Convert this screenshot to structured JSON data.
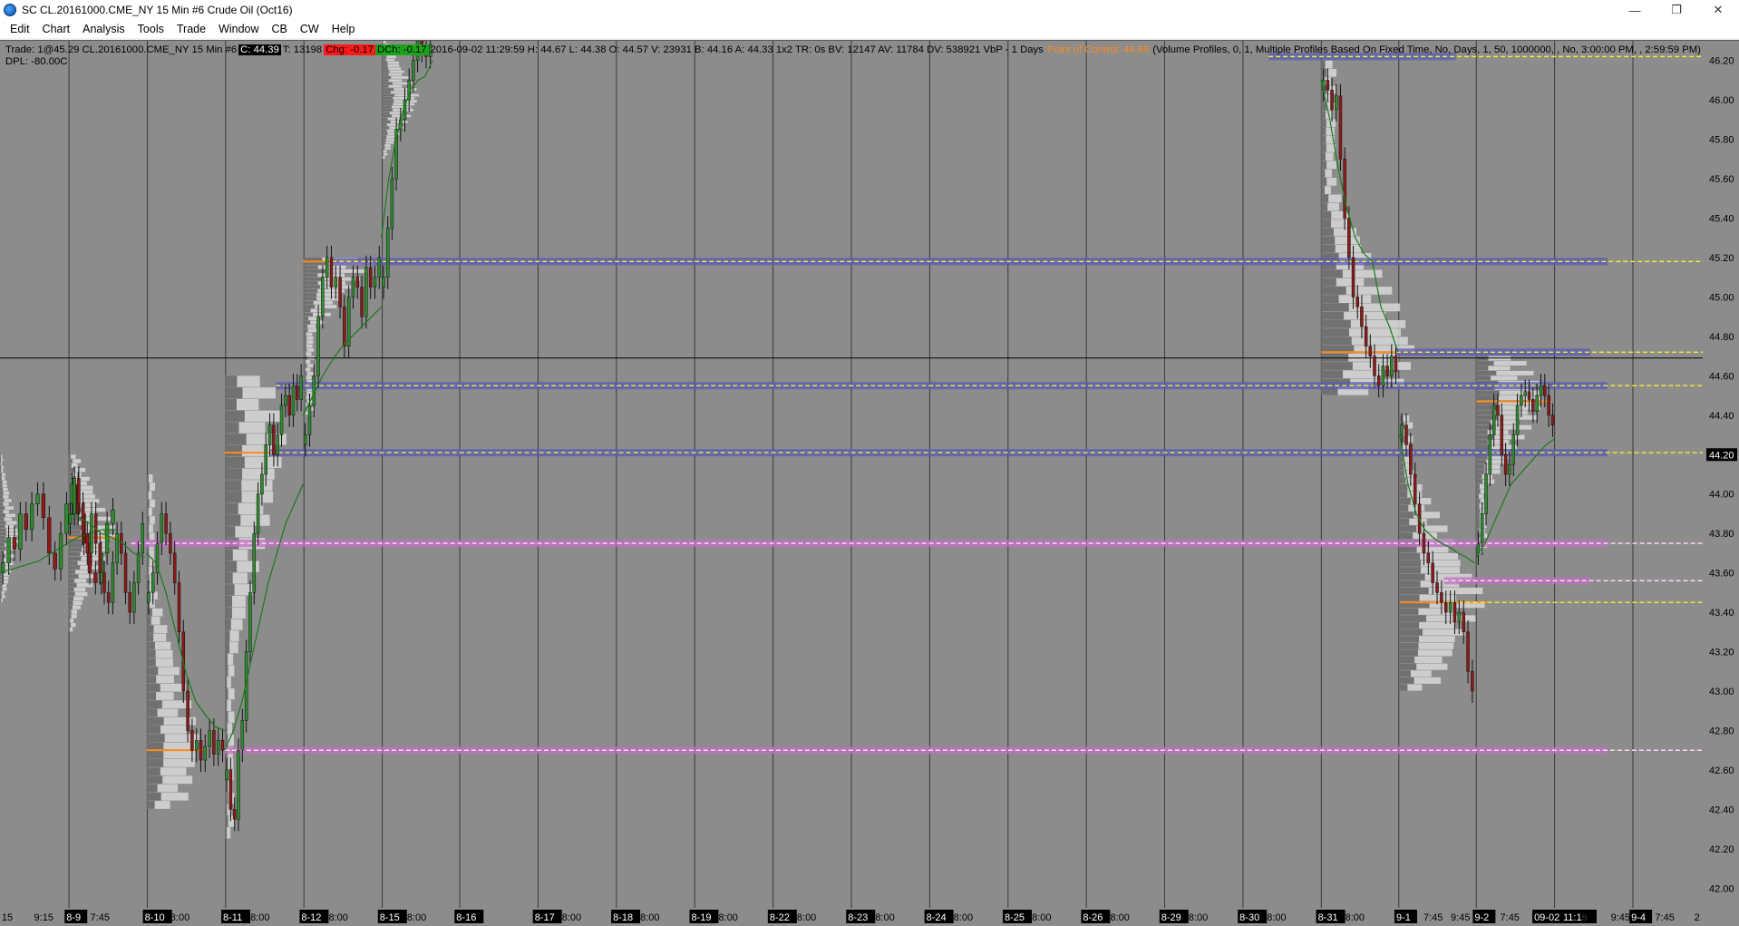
{
  "window": {
    "title": "SC CL.20161000.CME_NY  15 Min  #6  Crude Oil (Oct16)",
    "minimize_glyph": "—",
    "restore_glyph": "❐",
    "close_glyph": "✕"
  },
  "menu": [
    "Edit",
    "Chart",
    "Analysis",
    "Tools",
    "Trade",
    "Window",
    "CB",
    "CW",
    "Help"
  ],
  "info": {
    "trade": "Trade: 1@45.29  CL.20161000.CME_NY  15 Min  #6",
    "close": "C: 44.39",
    "trades": "T: 13198",
    "change": "Chg: -0.17",
    "dch": "DCh: -0.17",
    "bar_stats": "2016-09-02 11:29:59  H: 44.67  L: 44.38  O: 44.57  V: 23931  B: 44.16  A: 44.33  1x2  TR: 0s  BV: 12147  AV: 11784  DV: 538921  VbP - 1 Days",
    "poc_label": "Point of Control: 44.69",
    "study": "(Volume Profiles, 0, 1, Multiple Profiles Based On Fixed Time, No, Days, 1, 50, 1000000, , No, 3:00:00 PM, , 2:59:59 PM)",
    "dpl": "DPL: -80.00C"
  },
  "chart_data": {
    "type": "candlestick",
    "instrument": "CL.20161000.CME_NY",
    "timeframe": "15 Min",
    "y_ticks": [
      "46.20",
      "46.00",
      "45.80",
      "45.60",
      "45.40",
      "45.20",
      "45.00",
      "44.80",
      "44.60",
      "44.40",
      "44.20",
      "44.00",
      "43.80",
      "43.60",
      "43.40",
      "43.20",
      "43.00",
      "42.80",
      "42.60",
      "42.40",
      "42.20",
      "42.00"
    ],
    "ylim": [
      41.9,
      46.3
    ],
    "highlighted_prices": [
      "44.69",
      "44.20"
    ],
    "current_price_line": 44.69,
    "x_labels": [
      {
        "x": 0.001,
        "text": "15",
        "date": false
      },
      {
        "x": 0.02,
        "text": "9:15",
        "date": false
      },
      {
        "x": 0.039,
        "text": "8-9",
        "date": true
      },
      {
        "x": 0.053,
        "text": "7:45",
        "date": false
      },
      {
        "x": 0.085,
        "text": "8-10",
        "date": true
      },
      {
        "x": 0.1,
        "text": "8:00",
        "date": false
      },
      {
        "x": 0.131,
        "text": "8-11",
        "date": true
      },
      {
        "x": 0.147,
        "text": "8:00",
        "date": false
      },
      {
        "x": 0.177,
        "text": "8-12",
        "date": true
      },
      {
        "x": 0.193,
        "text": "8:00",
        "date": false
      },
      {
        "x": 0.223,
        "text": "8-15",
        "date": true
      },
      {
        "x": 0.239,
        "text": "8:00",
        "date": false
      },
      {
        "x": 0.268,
        "text": "8-16",
        "date": true
      },
      {
        "x": 0.314,
        "text": "8-17",
        "date": true
      },
      {
        "x": 0.33,
        "text": "8:00",
        "date": false
      },
      {
        "x": 0.36,
        "text": "8-18",
        "date": true
      },
      {
        "x": 0.376,
        "text": "8:00",
        "date": false
      },
      {
        "x": 0.406,
        "text": "8-19",
        "date": true
      },
      {
        "x": 0.422,
        "text": "8:00",
        "date": false
      },
      {
        "x": 0.452,
        "text": "8-22",
        "date": true
      },
      {
        "x": 0.468,
        "text": "8:00",
        "date": false
      },
      {
        "x": 0.498,
        "text": "8-23",
        "date": true
      },
      {
        "x": 0.514,
        "text": "8:00",
        "date": false
      },
      {
        "x": 0.544,
        "text": "8-24",
        "date": true
      },
      {
        "x": 0.56,
        "text": "8:00",
        "date": false
      },
      {
        "x": 0.59,
        "text": "8-25",
        "date": true
      },
      {
        "x": 0.606,
        "text": "8:00",
        "date": false
      },
      {
        "x": 0.636,
        "text": "8-26",
        "date": true
      },
      {
        "x": 0.652,
        "text": "8:00",
        "date": false
      },
      {
        "x": 0.682,
        "text": "8-29",
        "date": true
      },
      {
        "x": 0.698,
        "text": "8:00",
        "date": false
      },
      {
        "x": 0.728,
        "text": "8-30",
        "date": true
      },
      {
        "x": 0.744,
        "text": "8:00",
        "date": false
      },
      {
        "x": 0.774,
        "text": "8-31",
        "date": true
      },
      {
        "x": 0.79,
        "text": "8:00",
        "date": false
      },
      {
        "x": 0.82,
        "text": "9-1",
        "date": true
      },
      {
        "x": 0.836,
        "text": "7:45",
        "date": false
      },
      {
        "x": 0.852,
        "text": "9:45",
        "date": false
      },
      {
        "x": 0.866,
        "text": "9-2",
        "date": true
      },
      {
        "x": 0.881,
        "text": "7:45",
        "date": false
      },
      {
        "x": 0.901,
        "text": "09-02",
        "date": true
      },
      {
        "x": 0.918,
        "text": "11:15",
        "date": true
      },
      {
        "x": 0.929,
        "text": "5",
        "date": false
      },
      {
        "x": 0.946,
        "text": "9:45",
        "date": false
      },
      {
        "x": 0.958,
        "text": "9-4",
        "date": true
      },
      {
        "x": 0.972,
        "text": "7:45",
        "date": false
      },
      {
        "x": 0.995,
        "text": "2",
        "date": false
      }
    ],
    "session_dividers": [
      0.0405,
      0.0865,
      0.1325,
      0.1785,
      0.2245,
      0.27,
      0.316,
      0.362,
      0.408,
      0.454,
      0.5,
      0.546,
      0.592,
      0.638,
      0.684,
      0.73,
      0.776,
      0.8215,
      0.867,
      0.913,
      0.959
    ],
    "horizontal_levels": [
      {
        "price": 46.22,
        "x0": 0.745,
        "x1": 1.0,
        "band": "blue",
        "band_x0": 0.745,
        "band_x1": 0.855
      },
      {
        "price": 45.18,
        "x0": 0.195,
        "x1": 1.0,
        "band": "blue",
        "band_x0": 0.195,
        "band_x1": 0.944
      },
      {
        "price": 44.72,
        "x0": 0.82,
        "x1": 1.0,
        "band": "blue",
        "band_x0": 0.82,
        "band_x1": 0.934
      },
      {
        "price": 44.55,
        "x0": 0.162,
        "x1": 1.0,
        "band": "blue",
        "band_x0": 0.162,
        "band_x1": 0.944
      },
      {
        "price": 44.21,
        "x0": 0.159,
        "x1": 1.0,
        "band": "blue",
        "band_x0": 0.159,
        "band_x1": 0.944
      },
      {
        "price": 43.75,
        "x0": 0.077,
        "x1": 1.0,
        "band": "pink",
        "band_x0": 0.077,
        "band_x1": 0.944
      },
      {
        "price": 43.56,
        "x0": 0.848,
        "x1": 1.0,
        "band": "pink",
        "band_x0": 0.848,
        "band_x1": 0.934
      },
      {
        "price": 43.45,
        "x0": 0.848,
        "x1": 1.0,
        "band": "none",
        "band_x0": 0.848,
        "band_x1": 0.848
      },
      {
        "price": 42.7,
        "x0": 0.132,
        "x1": 1.0,
        "band": "pink",
        "band_x0": 0.132,
        "band_x1": 0.944
      }
    ],
    "sessions": [
      {
        "x0": 0.0,
        "x1": 0.068,
        "prices": [
          43.65,
          43.78,
          43.72,
          43.9,
          43.82,
          43.95,
          44.0,
          43.88,
          43.7,
          43.62,
          43.8,
          43.95,
          44.05,
          43.9,
          43.75,
          43.6,
          43.55,
          43.7,
          43.85,
          43.92
        ],
        "vwap": [
          43.6,
          43.62,
          43.64,
          43.66,
          43.7,
          43.74,
          43.78,
          43.8,
          43.82,
          43.82
        ]
      },
      {
        "x0": 0.04,
        "x1": 0.085,
        "prices": [
          43.9,
          44.08,
          43.95,
          43.8,
          43.7,
          43.9,
          43.75,
          43.6,
          43.5,
          43.45,
          43.65,
          43.8,
          43.7,
          43.5,
          43.4,
          43.55,
          43.7,
          43.85
        ],
        "vwap": [
          43.9,
          43.88,
          43.85,
          43.8,
          43.78,
          43.75,
          43.7,
          43.68
        ]
      },
      {
        "x0": 0.086,
        "x1": 0.132,
        "prices": [
          43.5,
          43.6,
          43.75,
          43.9,
          43.8,
          43.7,
          43.55,
          43.3,
          43.0,
          42.8,
          42.7,
          42.75,
          42.65,
          42.72,
          42.8,
          42.68,
          42.75,
          42.7
        ],
        "vwap": [
          43.7,
          43.65,
          43.5,
          43.3,
          43.1,
          42.95,
          42.88,
          42.82,
          42.8
        ]
      },
      {
        "x0": 0.132,
        "x1": 0.178,
        "prices": [
          42.6,
          42.4,
          42.35,
          42.7,
          42.85,
          43.2,
          43.5,
          43.8,
          44.0,
          44.1,
          44.25,
          44.35,
          44.2,
          44.3,
          44.45,
          44.5,
          44.4,
          44.55,
          44.48,
          44.6
        ],
        "vwap": [
          42.7,
          42.8,
          42.95,
          43.15,
          43.35,
          43.55,
          43.7,
          43.85,
          43.95,
          44.05
        ]
      },
      {
        "x0": 0.178,
        "x1": 0.224,
        "prices": [
          44.3,
          44.45,
          44.6,
          44.9,
          45.1,
          45.2,
          45.05,
          45.1,
          44.95,
          44.75,
          45.0,
          45.1,
          45.05,
          44.9,
          45.15,
          45.05,
          45.1,
          45.2
        ],
        "vwap": [
          44.4,
          44.5,
          44.6,
          44.68,
          44.75,
          44.8,
          44.85,
          44.9,
          44.95
        ]
      },
      {
        "x0": 0.224,
        "x1": 0.254,
        "prices": [
          45.1,
          45.35,
          45.6,
          45.85,
          45.9,
          46.0,
          46.1,
          46.2,
          46.3,
          46.25,
          46.22,
          46.28
        ],
        "vwap": [
          45.3,
          45.6,
          45.8,
          45.95,
          46.05,
          46.1,
          46.12,
          46.2
        ]
      },
      {
        "x0": 0.776,
        "x1": 0.821,
        "prices": [
          46.1,
          46.05,
          45.95,
          46.02,
          45.7,
          45.4,
          45.2,
          45.0,
          44.95,
          44.85,
          44.75,
          44.7,
          44.6,
          44.55,
          44.65,
          44.6,
          44.7,
          44.62
        ],
        "vwap": [
          46.1,
          45.9,
          45.65,
          45.45,
          45.3,
          45.22,
          45.18,
          44.95,
          44.85,
          44.72
        ]
      },
      {
        "x0": 0.822,
        "x1": 0.866,
        "prices": [
          44.35,
          44.25,
          44.1,
          43.95,
          43.8,
          43.7,
          43.65,
          43.55,
          43.5,
          43.45,
          43.4,
          43.45,
          43.35,
          43.4,
          43.3,
          43.1,
          43.0
        ],
        "vwap": [
          44.3,
          44.05,
          43.9,
          43.82,
          43.78,
          43.75,
          43.73,
          43.7,
          43.68,
          43.65
        ]
      },
      {
        "x0": 0.867,
        "x1": 0.913,
        "prices": [
          43.75,
          43.9,
          44.1,
          44.3,
          44.45,
          44.4,
          44.2,
          44.1,
          44.15,
          44.3,
          44.45,
          44.5,
          44.52,
          44.48,
          44.42,
          44.5,
          44.55,
          44.5,
          44.4,
          44.35
        ],
        "vwap": [
          43.68,
          43.75,
          43.85,
          43.95,
          44.05,
          44.1,
          44.15,
          44.2,
          44.25,
          44.28
        ]
      }
    ],
    "profiles": [
      {
        "x": 0.0,
        "lo": 43.45,
        "hi": 44.2,
        "poc": 43.78,
        "width": 0.012,
        "poc_color": "none"
      },
      {
        "x": 0.04,
        "lo": 43.3,
        "hi": 44.2,
        "poc": 43.78,
        "width": 0.03,
        "poc_color": "orange"
      },
      {
        "x": 0.086,
        "lo": 42.4,
        "hi": 44.1,
        "poc": 42.7,
        "width": 0.034,
        "poc_color": "orange"
      },
      {
        "x": 0.132,
        "lo": 42.25,
        "hi": 44.6,
        "poc": 44.21,
        "width": 0.038,
        "poc_color": "orange"
      },
      {
        "x": 0.178,
        "lo": 44.4,
        "hi": 45.2,
        "poc": 45.18,
        "width": 0.044,
        "poc_color": "orange"
      },
      {
        "x": 0.224,
        "lo": 45.7,
        "hi": 46.3,
        "poc": 46.0,
        "width": 0.024,
        "poc_color": "none"
      },
      {
        "x": 0.776,
        "lo": 44.5,
        "hi": 46.2,
        "poc": 44.72,
        "width": 0.06,
        "poc_color": "orange"
      },
      {
        "x": 0.822,
        "lo": 43.0,
        "hi": 44.4,
        "poc": 43.45,
        "width": 0.052,
        "poc_color": "orange"
      },
      {
        "x": 0.867,
        "lo": 43.7,
        "hi": 44.7,
        "poc": 44.47,
        "width": 0.044,
        "poc_color": "orange"
      }
    ],
    "colors": {
      "background": "#8c8c8c",
      "up_candle": "#2e8b2e",
      "down_candle": "#8b1a1a",
      "vwap": "#1a7a1a",
      "profile_light": "#d8d8d8",
      "profile_dark": "#4a4a4a",
      "poc": "#ff8a1a",
      "blue_band": "#5a5ab8",
      "pink_band": "#c070c0",
      "level_line": "#f0f030",
      "divider": "#3a3a3a"
    }
  }
}
